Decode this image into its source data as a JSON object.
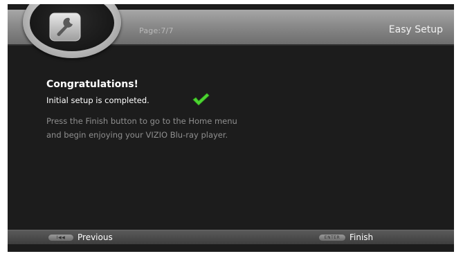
{
  "header": {
    "page_indicator": "Page:7/7",
    "title": "Easy Setup",
    "icon": "wrench-icon"
  },
  "main": {
    "heading": "Congratulations!",
    "status": "Initial setup is completed.",
    "status_icon": "checkmark-icon",
    "description_line1": "Press the Finish button to go to the Home menu",
    "description_line2": "and begin enjoying your VIZIO Blu-ray player."
  },
  "footer": {
    "previous": {
      "key": "I◀◀",
      "label": "Previous"
    },
    "finish": {
      "key": "ENTER",
      "label": "Finish"
    }
  },
  "colors": {
    "background": "#1c1c1c",
    "check_green": "#4cd431",
    "description_text": "#8f8f8f"
  }
}
